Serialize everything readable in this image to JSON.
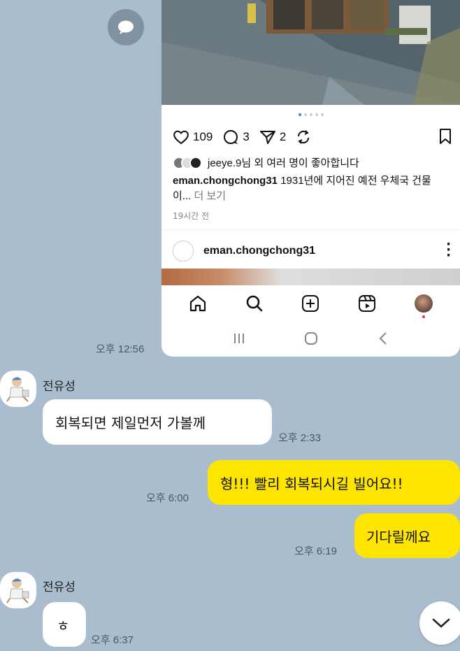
{
  "shared_post": {
    "actions": {
      "likes": "109",
      "comments": "3",
      "shares": "2"
    },
    "liked_by": "jeeye.9님 외 여러 명이 좋아합니다",
    "caption_user": "eman.chongchong31",
    "caption_text": " 1931년에 지어진 예전 우체국 건물이...",
    "more_label": " 더 보기",
    "time_ago": "19시간 전",
    "next_post_user": "eman.chongchong31"
  },
  "messages": [
    {
      "time": "오후 12:56"
    },
    {
      "sender": "전유성",
      "text": "회복되면 제일먼저 가볼께",
      "time": "오후 2:33"
    },
    {
      "text": "형!!! 빨리 회복되시길 빌어요!!",
      "time": "오후 6:00"
    },
    {
      "text": "기다릴께요",
      "time": "오후 6:19"
    },
    {
      "sender": "전유성",
      "text": "ㅎ",
      "time": "오후 6:37"
    }
  ],
  "colors": {
    "chat_bg": "#a9bdce",
    "out_bubble": "#fee500",
    "in_bubble": "#ffffff"
  }
}
